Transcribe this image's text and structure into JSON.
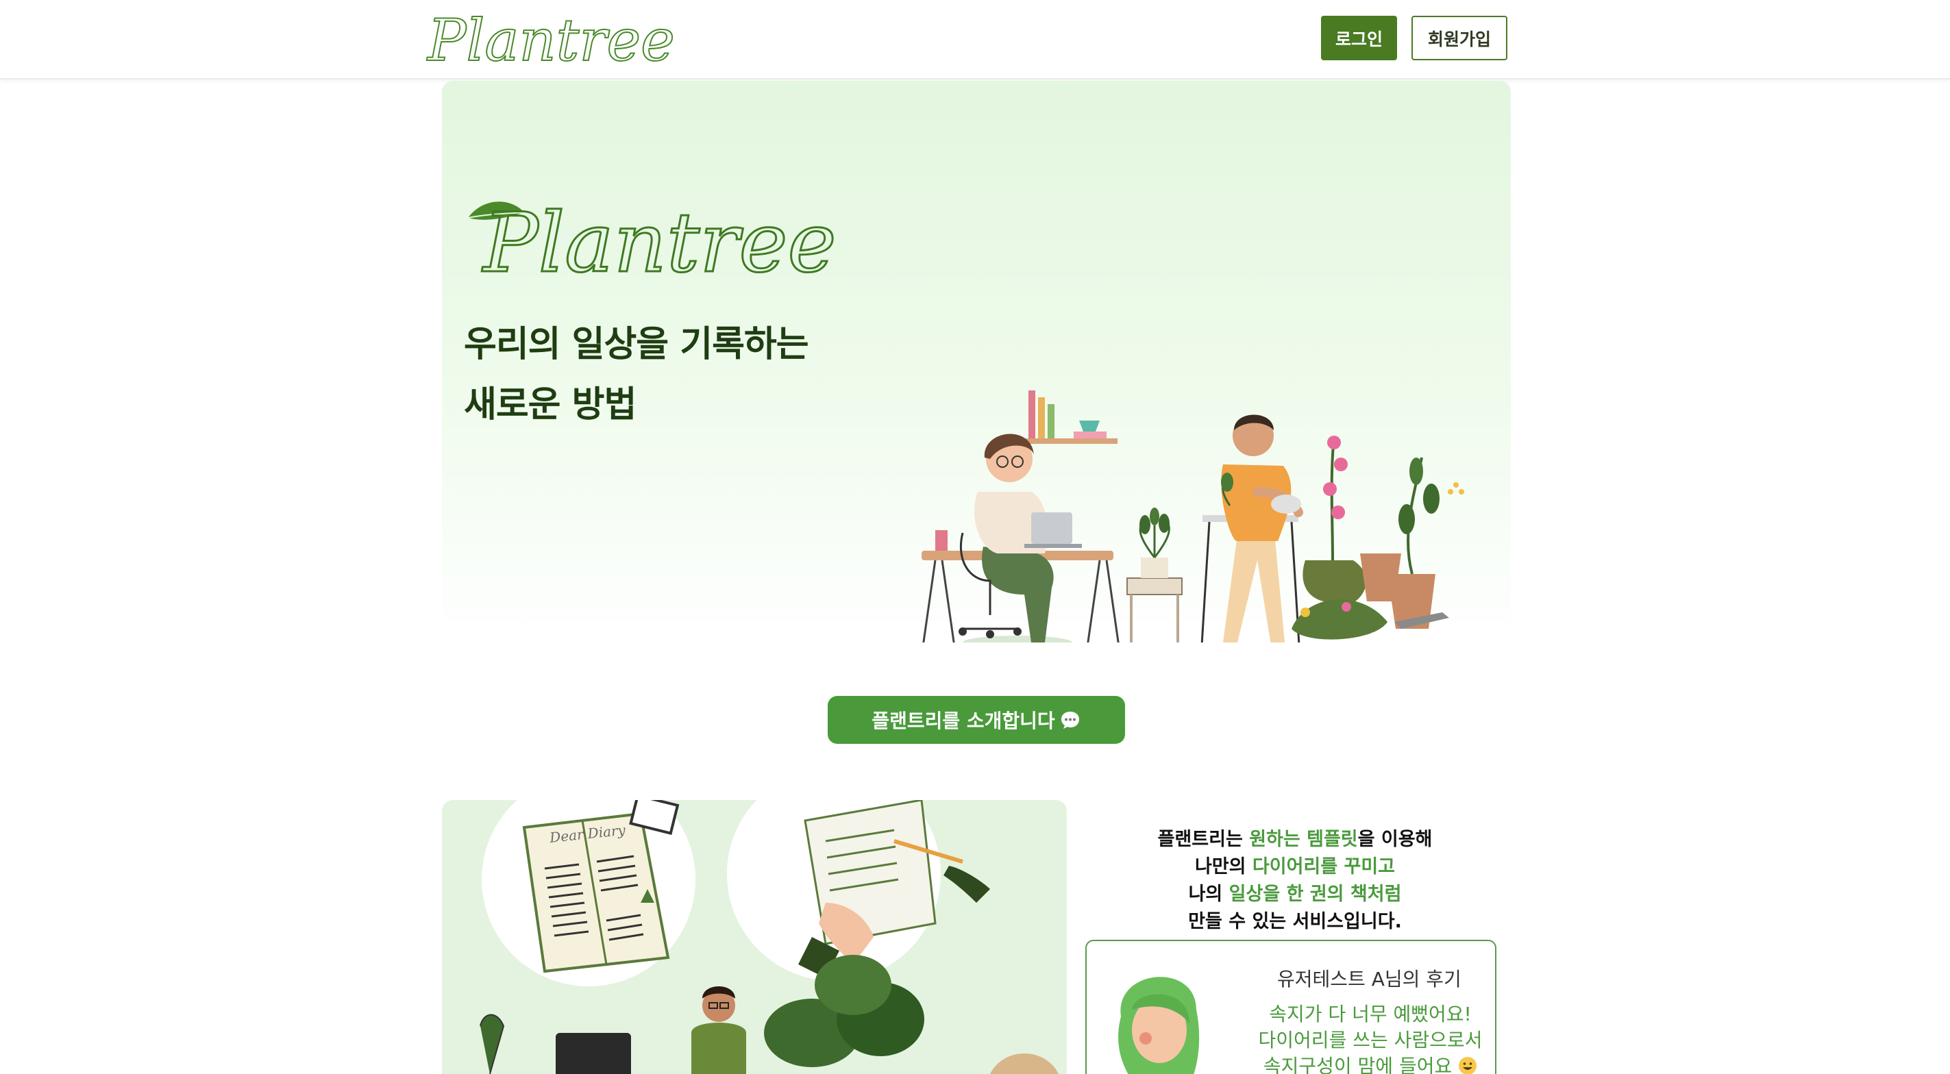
{
  "header": {
    "logo_text": "Plantree",
    "login_label": "로그인",
    "signup_label": "회원가입"
  },
  "hero": {
    "logo_text": "Plantree",
    "headline_line1": "우리의 일상을 기록하는",
    "headline_line2": "새로운 방법"
  },
  "intro": {
    "button_label": "플랜트리를 소개합니다",
    "icon": "speech-bubble-icon"
  },
  "description": {
    "lines": [
      [
        {
          "text": "플랜트리는 ",
          "hl": false
        },
        {
          "text": "원하는 템플릿",
          "hl": true
        },
        {
          "text": "을 이용해",
          "hl": false
        }
      ],
      [
        {
          "text": "나만의 ",
          "hl": false
        },
        {
          "text": "다이어리를 꾸미고",
          "hl": true
        }
      ],
      [
        {
          "text": "나의 ",
          "hl": false
        },
        {
          "text": "일상을 한 권의 책처럼",
          "hl": true
        }
      ],
      [
        {
          "text": "만들 수 있는 서비스입니다.",
          "hl": false
        }
      ]
    ]
  },
  "review": {
    "title": "유저테스트 A님의 후기",
    "line1": "속지가 다 너무 예뻤어요!",
    "line2": "다이어리를 쓰는 사람으로서",
    "line3": "속지구성이 맘에 들어요",
    "emoji": "grinning-face-icon"
  },
  "diary_art": {
    "diary_caption": "Dear Diary"
  },
  "colors": {
    "brand_green": "#4a7a22",
    "accent_green": "#4a9a3c",
    "headline": "#1f3d12",
    "hero_bg": "#e3f6df"
  }
}
